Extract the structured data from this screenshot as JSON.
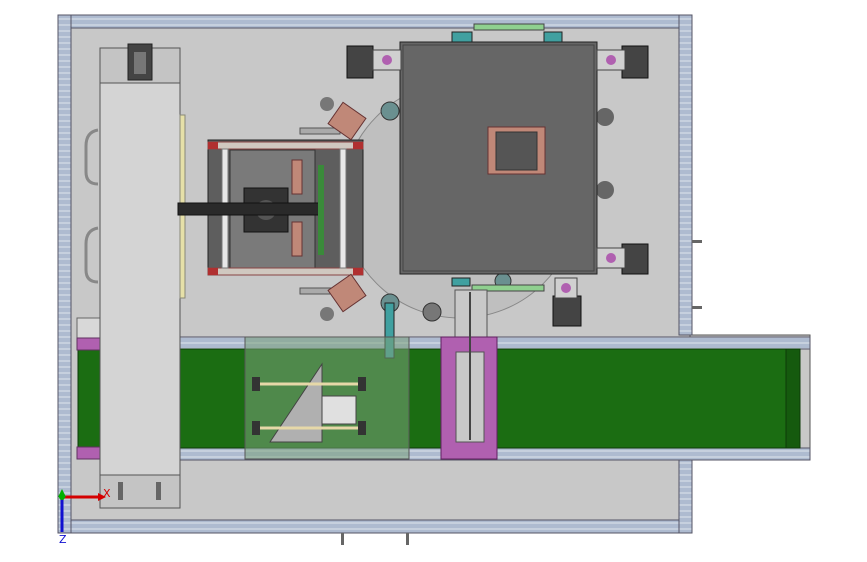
{
  "viewport": {
    "background": "#ffffff"
  },
  "triad": {
    "x_label": "X",
    "z_label": "Z",
    "x_color": "#d40000",
    "y_color": "#00b000",
    "z_color": "#1010d0"
  },
  "colors": {
    "frame_rail": "#a9b5c8",
    "base_plate": "#c6c6c6",
    "conveyor_belt": "#1b6d12",
    "dark_box": "#6a6a6a",
    "accent_purple": "#b060b0",
    "accent_teal": "#40a0a0",
    "accent_copper": "#c08878"
  }
}
